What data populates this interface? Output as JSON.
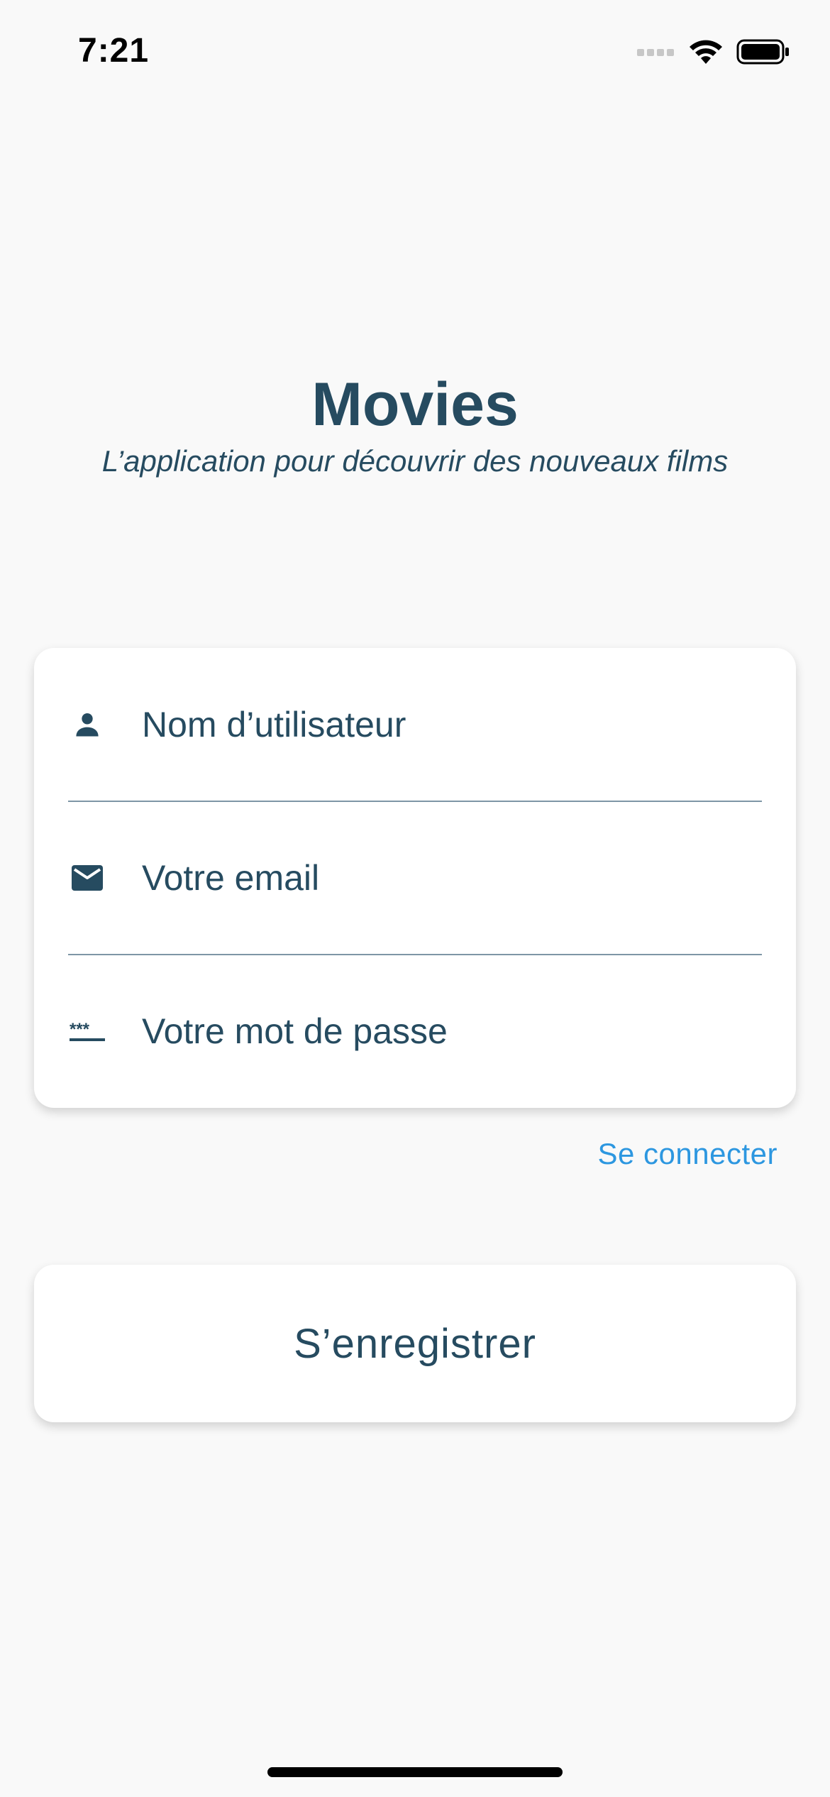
{
  "status_bar": {
    "time": "7:21",
    "icons": [
      "cellular-signal-icon",
      "wifi-icon",
      "battery-icon"
    ]
  },
  "header": {
    "title": "Movies",
    "subtitle": "L’application pour découvrir des nouveaux films"
  },
  "form": {
    "username": {
      "icon": "person-icon",
      "placeholder": "Nom d’utilisateur",
      "value": ""
    },
    "email": {
      "icon": "mail-icon",
      "placeholder": "Votre email",
      "value": ""
    },
    "password": {
      "icon": "password-icon",
      "placeholder": "Votre mot de passe",
      "value": ""
    }
  },
  "actions": {
    "login_label": "Se connecter",
    "register_label": "S’enregistrer"
  },
  "colors": {
    "background": "#f9f9f9",
    "primary_text": "#264b60",
    "link": "#2d97e0",
    "card": "#ffffff",
    "divider": "#7e96a6"
  }
}
